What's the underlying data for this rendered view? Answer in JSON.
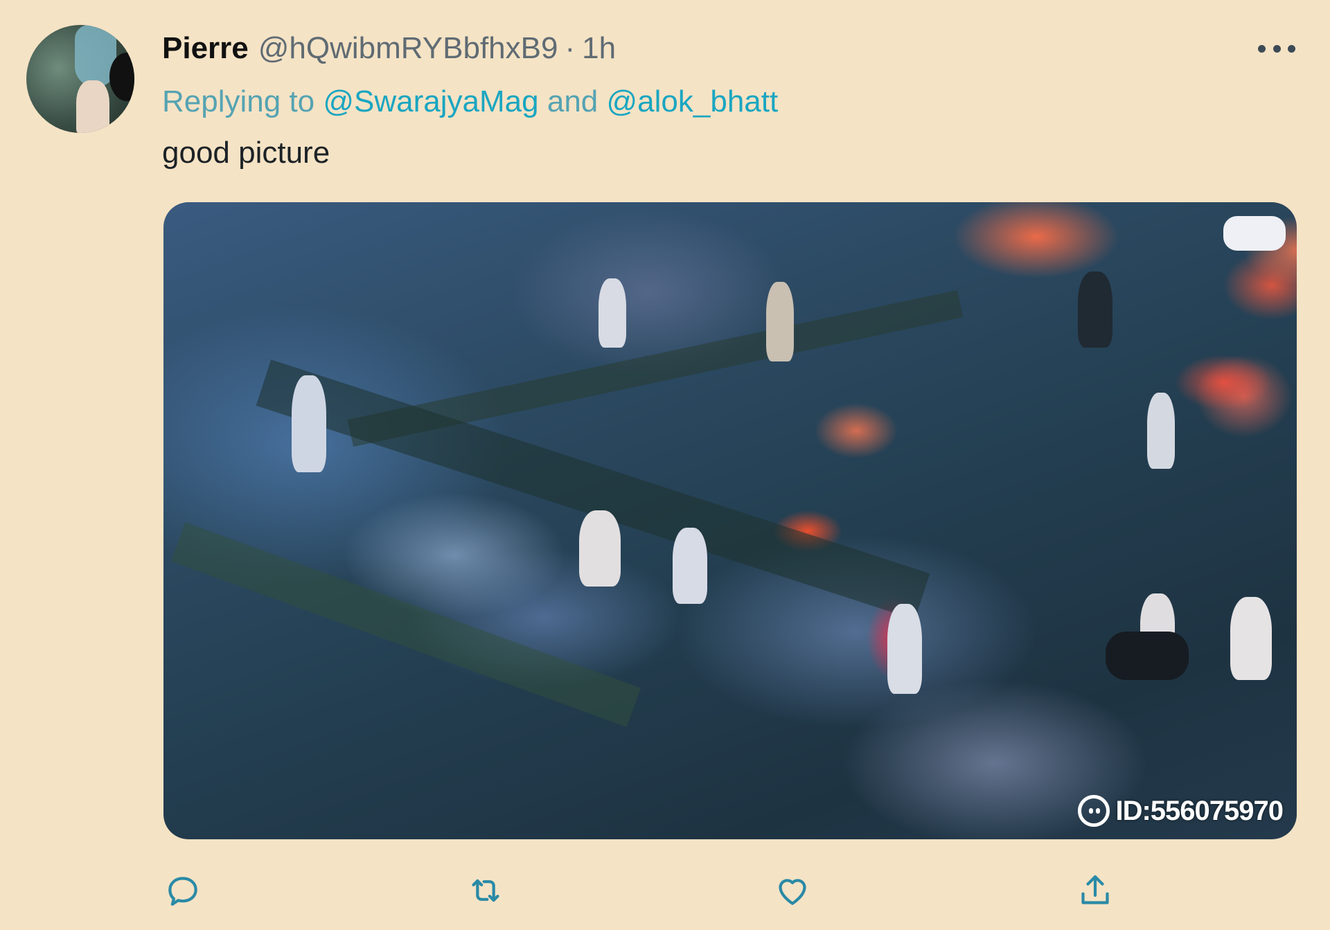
{
  "tweet": {
    "author_name": "Pierre",
    "author_handle": "@hQwibmRYBbfhxB9",
    "separator": "·",
    "time": "1h",
    "reply": {
      "prefix": "Replying to",
      "mention_1": "@SwarajyaMag",
      "conjunction": "and",
      "mention_2": "@alok_bhatt"
    },
    "text": "good picture",
    "media_watermark": "ID:556075970"
  },
  "icons": {
    "more": "more-dots-icon",
    "reply": "reply-icon",
    "retweet": "retweet-icon",
    "like": "heart-icon",
    "share": "share-icon",
    "watermark": "watermark-logo-icon"
  },
  "colors": {
    "background": "#f5e3c5",
    "link": "#1aa6c1",
    "muted": "#5f6b73",
    "action_icon": "#2a8aa6"
  }
}
